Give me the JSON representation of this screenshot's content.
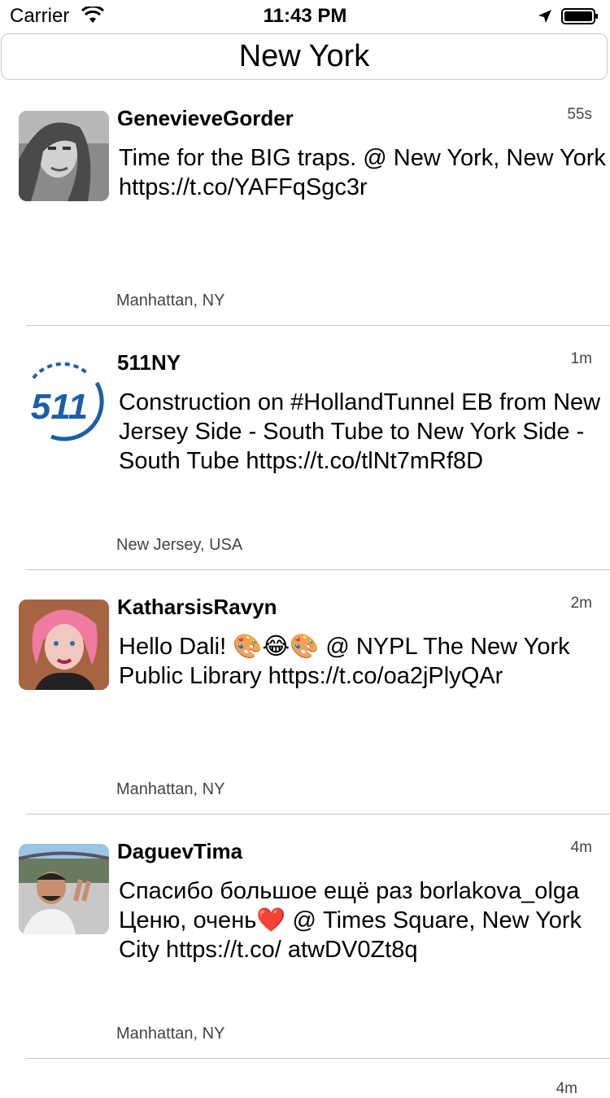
{
  "status_bar": {
    "carrier": "Carrier",
    "time": "11:43 PM",
    "icons": [
      "wifi-icon",
      "location-arrow-icon",
      "battery-icon"
    ]
  },
  "search": {
    "value": "New York"
  },
  "tweets": [
    {
      "username": "GenevieveGorder",
      "time": "55s",
      "text": "Time for the BIG traps. @ New York, New York https://t.co/YAFFqSgc3r",
      "place": "Manhattan, NY"
    },
    {
      "username": "511NY",
      "time": "1m",
      "text": "Construction on #HollandTunnel EB from New Jersey Side - South Tube to New York Side - South Tube https://t.co/tlNt7mRf8D",
      "place": "New Jersey, USA",
      "logo_text": "511"
    },
    {
      "username": "KatharsisRavyn",
      "time": "2m",
      "text": "Hello Dali! 🎨😂🎨 @ NYPL The New York Public Library https://t.co/oa2jPlyQAr",
      "place": "Manhattan, NY"
    },
    {
      "username": "DaguevTima",
      "time": "4m",
      "text": "Спасибо большое ещё раз borlakova_olga Ценю, очень❤️ @ Times Square, New York City https://t.co/ atwDV0Zt8q",
      "place": "Manhattan, NY"
    }
  ],
  "next_tweet_time": "4m",
  "colors": {
    "separator": "#c8c7cc",
    "logo_blue": "#1c5ea8"
  }
}
